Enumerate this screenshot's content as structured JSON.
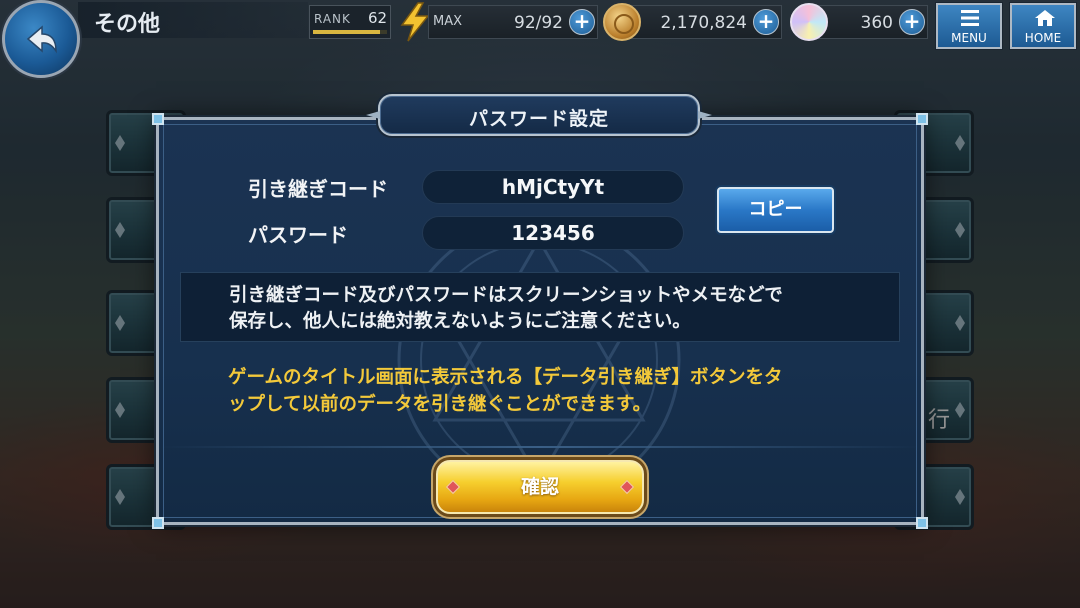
{
  "header": {
    "screen_title": "その他",
    "rank_label": "RANK",
    "rank_value": "62",
    "rank_progress": 0.9,
    "stamina_max_label": "MAX",
    "stamina_value": "92/92",
    "coins_value": "2,170,824",
    "gems_value": "360",
    "plus_symbol": "+",
    "menu_label": "MENU",
    "home_label": "HOME",
    "back_icon": "back-arrow-icon",
    "stamina_icon": "lightning-bolt-icon",
    "coin_icon": "gold-coin-icon",
    "gem_icon": "rainbow-gem-icon"
  },
  "dialog": {
    "title": "パスワード設定",
    "transfer_code_label": "引き継ぎコード",
    "transfer_code_value": "hMjCtyYt",
    "password_label": "パスワード",
    "password_value": "123456",
    "copy_button": "コピー",
    "notice_line1": "引き継ぎコード及びパスワードはスクリーンショットやメモなどで",
    "notice_line2": "保存し、他人には絶対教えないようにご注意ください。",
    "info_line1": "ゲームのタイトル画面に表示される【データ引き継ぎ】ボタンをタ",
    "info_line2": "ップして以前のデータを引き継ぐことができます。",
    "confirm_button": "確認"
  },
  "background": {
    "partial_glyph": "行"
  },
  "colors": {
    "dialog_bg": "#17304e",
    "info_text": "#f3c93a",
    "copy_button": "#2a78c7",
    "confirm_button": "#f6cf2e"
  }
}
